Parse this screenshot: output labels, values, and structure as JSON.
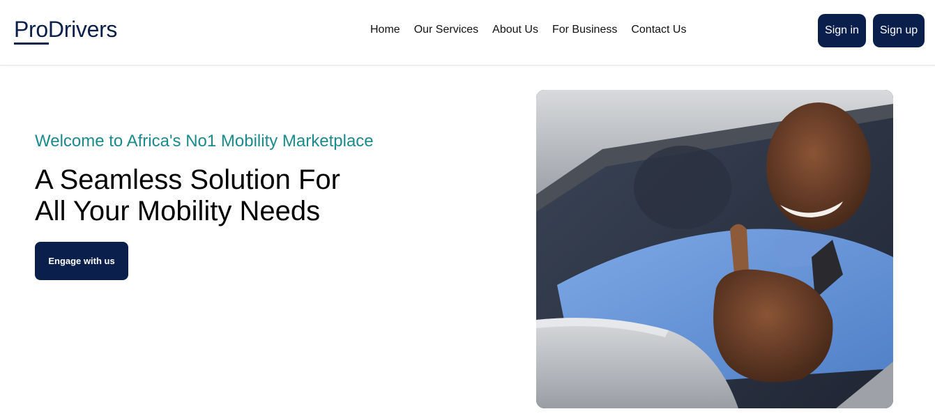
{
  "header": {
    "logo": "ProDrivers",
    "nav": [
      "Home",
      "Our Services",
      "About Us",
      "For Business",
      "Contact Us"
    ],
    "signin_label": "Sign in",
    "signup_label": "Sign up"
  },
  "hero": {
    "tagline": "Welcome to Africa's No1 Mobility Marketplace",
    "headline_line1": "A Seamless Solution For",
    "headline_line2": "All Your Mobility Needs",
    "cta_label": "Engage with us",
    "image": "smiling driver giving thumbs up from car window"
  },
  "colors": {
    "brand": "#0b1f4d",
    "accent": "#1a8a8c"
  }
}
